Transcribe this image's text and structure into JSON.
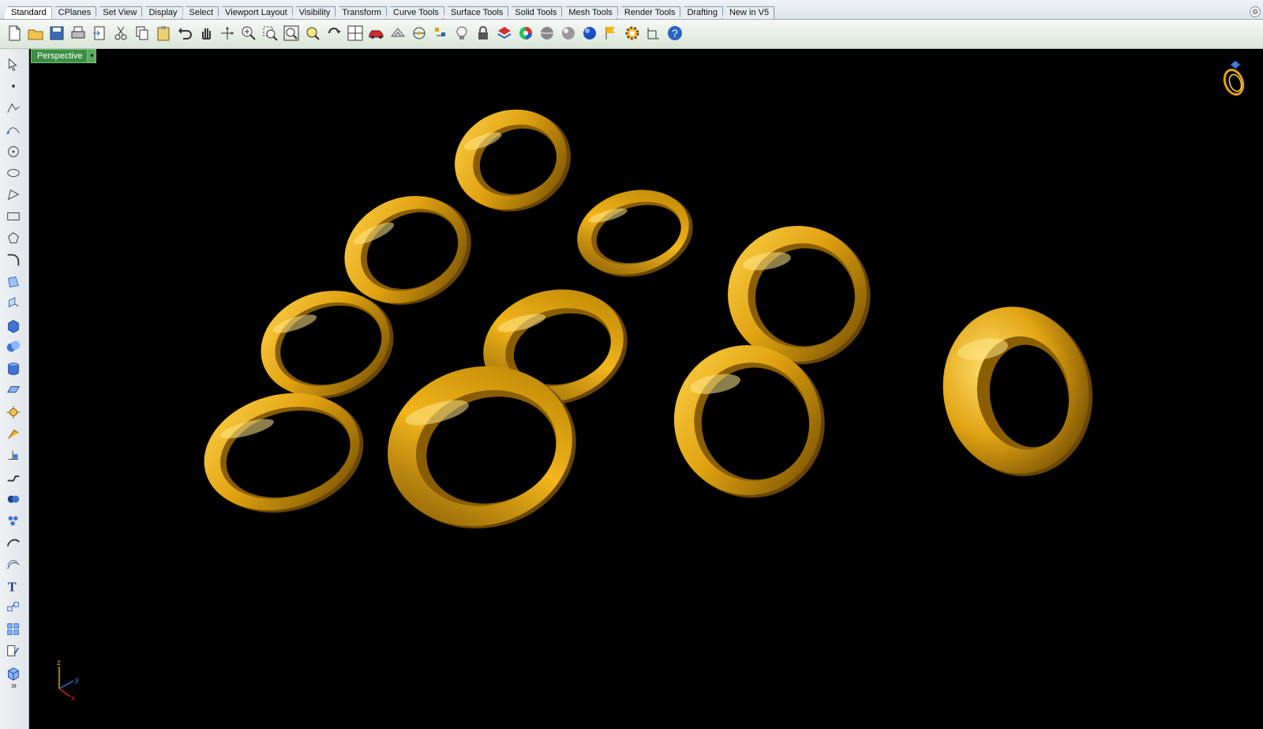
{
  "tabs": [
    {
      "label": "Standard",
      "active": true
    },
    {
      "label": "CPlanes"
    },
    {
      "label": "Set View"
    },
    {
      "label": "Display"
    },
    {
      "label": "Select"
    },
    {
      "label": "Viewport Layout"
    },
    {
      "label": "Visibility"
    },
    {
      "label": "Transform"
    },
    {
      "label": "Curve Tools"
    },
    {
      "label": "Surface Tools"
    },
    {
      "label": "Solid Tools"
    },
    {
      "label": "Mesh Tools"
    },
    {
      "label": "Render Tools"
    },
    {
      "label": "Drafting"
    },
    {
      "label": "New in V5"
    }
  ],
  "toolbar": {
    "icons": [
      "new-file",
      "open-folder",
      "save",
      "print",
      "import",
      "cut",
      "copy",
      "paste",
      "undo",
      "pan-hand",
      "move-axes",
      "zoom-in",
      "zoom-window",
      "zoom-extents",
      "zoom-selected",
      "rotate-view",
      "four-viewports",
      "car-render",
      "mesh-settings",
      "osnap",
      "points",
      "light-bulb",
      "lock",
      "layers",
      "color-wheel",
      "shade-sphere",
      "render-sphere",
      "blue-sphere",
      "flag-tool",
      "gear-settings",
      "dimension",
      "help"
    ]
  },
  "sidebar": {
    "icons": [
      "select-arrow",
      "point",
      "polyline",
      "curve-point",
      "circle",
      "ellipse",
      "polygon",
      "rectangle",
      "polygon-star",
      "fillet",
      "surface-from-points",
      "extrude",
      "solid-box",
      "solid-boolean",
      "cylinder",
      "plane",
      "explode",
      "snap",
      "transform",
      "join",
      "boolean-union",
      "boolean-split",
      "curve",
      "offset-curve",
      "text",
      "group",
      "array",
      "properties",
      "mesh-box"
    ],
    "more_label": "»"
  },
  "viewport": {
    "title": "Perspective",
    "menu_arrow": "▾",
    "background": "#000000",
    "axis_labels": {
      "z": "z",
      "y": "y",
      "x": "x"
    }
  },
  "colors": {
    "gold": "#e0a211",
    "gold_light": "#ffd24a",
    "gold_dark": "#7a5200",
    "viewport_tab": "#3c8f44"
  },
  "tab_options_icon": "⚙"
}
